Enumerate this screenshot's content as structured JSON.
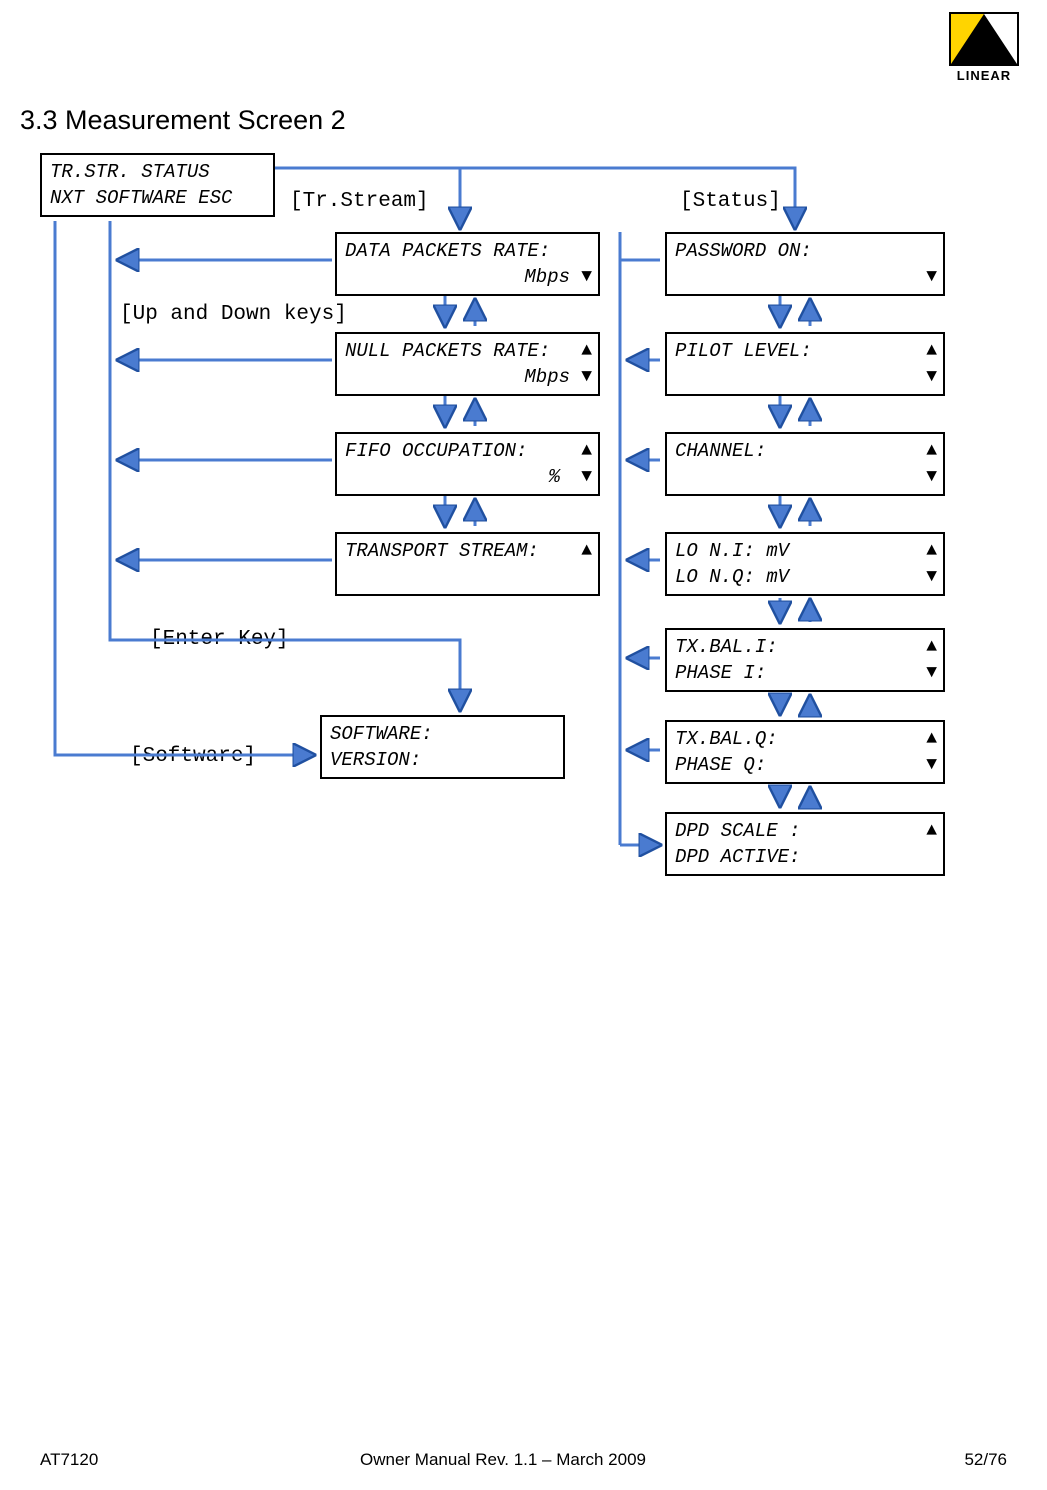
{
  "heading": "3.3 Measurement Screen 2",
  "logo_text": "LINEAR",
  "menu": {
    "row1": "TR.STR.   STATUS",
    "row2": "NXT  SOFTWARE  ESC"
  },
  "labels": {
    "tr_stream": "[Tr.Stream]",
    "status": "[Status]",
    "up_down": "[Up and Down keys]",
    "enter": "[Enter Key]",
    "software": "[Software]"
  },
  "left_boxes": {
    "data_packets": {
      "l1": "DATA PACKETS RATE:",
      "l2": "Mbps"
    },
    "null_packets": {
      "l1": "NULL PACKETS RATE:",
      "l2": "Mbps"
    },
    "fifo": {
      "l1": "FIFO OCCUPATION:",
      "l2": "%"
    },
    "transport": {
      "l1": "TRANSPORT STREAM:",
      "l2": ""
    },
    "software": {
      "l1": "SOFTWARE:",
      "l2": "VERSION:"
    }
  },
  "right_boxes": {
    "password": {
      "l1": "PASSWORD ON:",
      "l2": ""
    },
    "pilot": {
      "l1": "PILOT LEVEL:",
      "l2": ""
    },
    "channel": {
      "l1": "CHANNEL:",
      "l2": ""
    },
    "lo": {
      "l1": "LO N.I:        mV",
      "l2": "LO N.Q:        mV"
    },
    "txbal_i": {
      "l1": "TX.BAL.I:",
      "l2": "PHASE  I:"
    },
    "txbal_q": {
      "l1": "TX.BAL.Q:",
      "l2": "PHASE  Q:"
    },
    "dpd": {
      "l1": "DPD SCALE :",
      "l2": "DPD ACTIVE:"
    }
  },
  "footer": {
    "left": "AT7120",
    "center": "Owner Manual Rev. 1.1 – March 2009",
    "right": "52/76"
  }
}
